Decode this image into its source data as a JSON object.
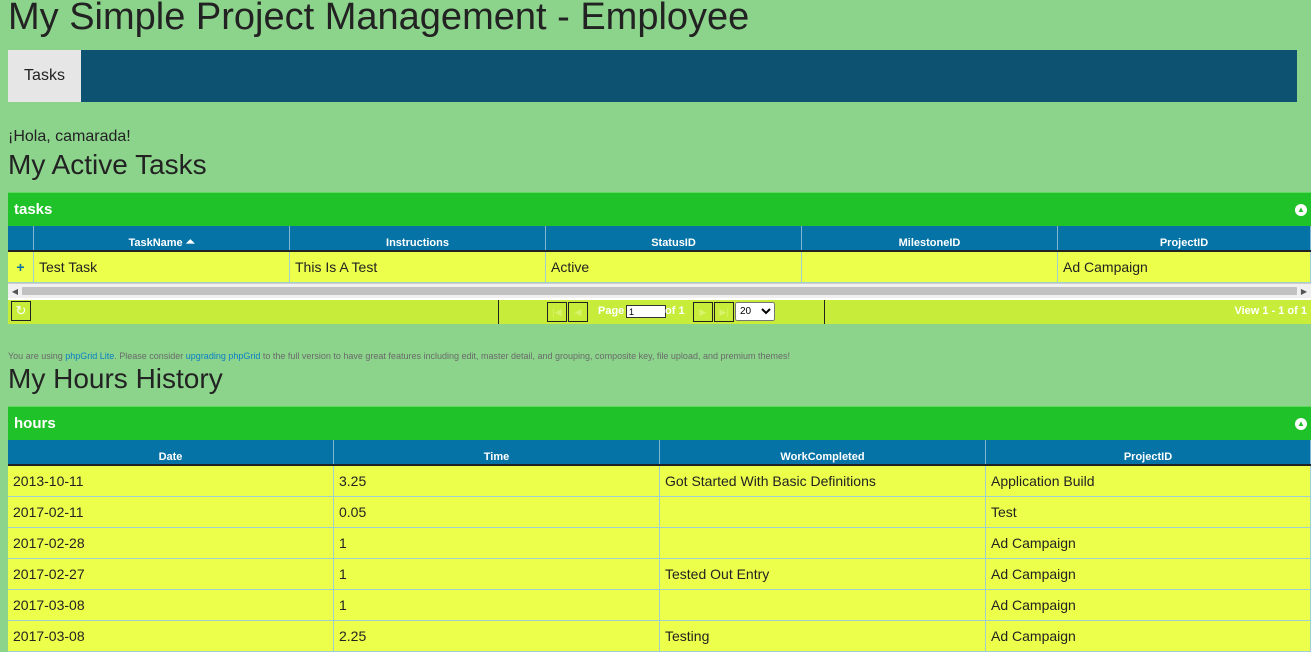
{
  "page": {
    "title": "My Simple Project Management - Employee"
  },
  "nav": {
    "tabs": [
      {
        "label": "Tasks"
      }
    ]
  },
  "greeting": "¡Hola, camarada!",
  "tasks_section": {
    "heading": "My Active Tasks",
    "caption": "tasks",
    "columns": [
      "TaskName",
      "Instructions",
      "StatusID",
      "MilestoneID",
      "ProjectID"
    ],
    "sort_indicator": "⏶",
    "expand_symbol": "+",
    "rows": [
      {
        "TaskName": "Test Task",
        "Instructions": "This Is A Test",
        "StatusID": "Active",
        "MilestoneID": "",
        "ProjectID": "Ad Campaign"
      }
    ],
    "pager": {
      "page_label": "Page",
      "page_value": "1",
      "of_label": "of 1",
      "rows_per_page": "20",
      "rows_per_page_options": [
        "20"
      ],
      "view_info": "View 1 - 1 of 1"
    }
  },
  "notice": {
    "pre": "You are using ",
    "link1": "phpGrid Lite",
    "mid": ". Please consider ",
    "link2": "upgrading phpGrid",
    "post": " to the full version to have great features including edit, master detail, and grouping, composite key, file upload, and premium themes!"
  },
  "hours_section": {
    "heading": "My Hours History",
    "caption": "hours",
    "columns": [
      "Date",
      "Time",
      "WorkCompleted",
      "ProjectID"
    ],
    "rows": [
      {
        "Date": "2013-10-11",
        "Time": "3.25",
        "WorkCompleted": "Got Started With Basic Definitions",
        "ProjectID": "Application Build"
      },
      {
        "Date": "2017-02-11",
        "Time": "0.05",
        "WorkCompleted": "",
        "ProjectID": "Test"
      },
      {
        "Date": "2017-02-28",
        "Time": "1",
        "WorkCompleted": "",
        "ProjectID": "Ad Campaign"
      },
      {
        "Date": "2017-02-27",
        "Time": "1",
        "WorkCompleted": "Tested Out Entry",
        "ProjectID": "Ad Campaign"
      },
      {
        "Date": "2017-03-08",
        "Time": "1",
        "WorkCompleted": "",
        "ProjectID": "Ad Campaign"
      },
      {
        "Date": "2017-03-08",
        "Time": "2.25",
        "WorkCompleted": "Testing",
        "ProjectID": "Ad Campaign"
      }
    ]
  },
  "colors": {
    "page_bg": "#8cd48c",
    "nav_bg": "#0e5272",
    "caption_bg": "#20c229",
    "header_bg": "#0573a6",
    "row_bg": "#ecff4a",
    "pager_bg": "#c8ec3a"
  }
}
